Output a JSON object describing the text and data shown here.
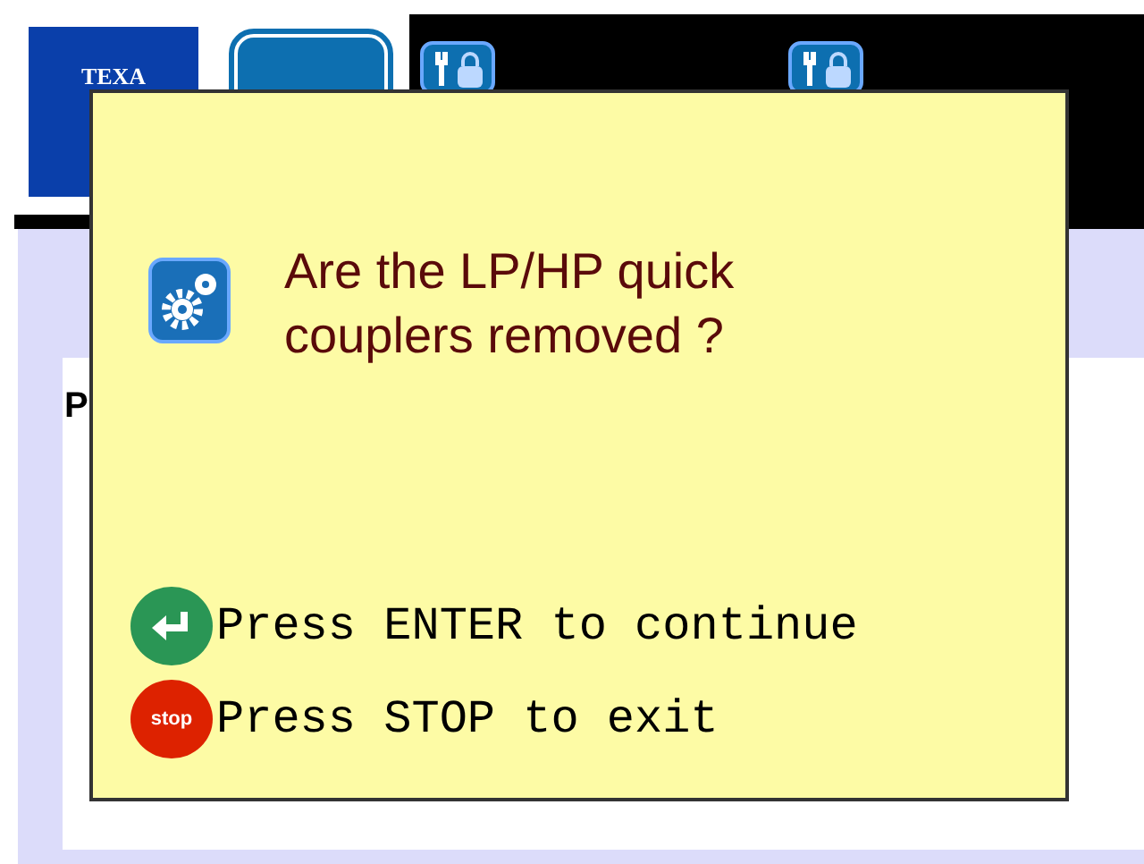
{
  "header": {
    "logo": "TEXA"
  },
  "background": {
    "panel_text": "P"
  },
  "dialog": {
    "question": "Are the LP/HP quick couplers removed ?",
    "instructions": [
      {
        "kind": "enter",
        "text": "Press ENTER to continue"
      },
      {
        "kind": "stop",
        "icon_label": "stop",
        "text": "Press STOP to exit"
      }
    ]
  }
}
